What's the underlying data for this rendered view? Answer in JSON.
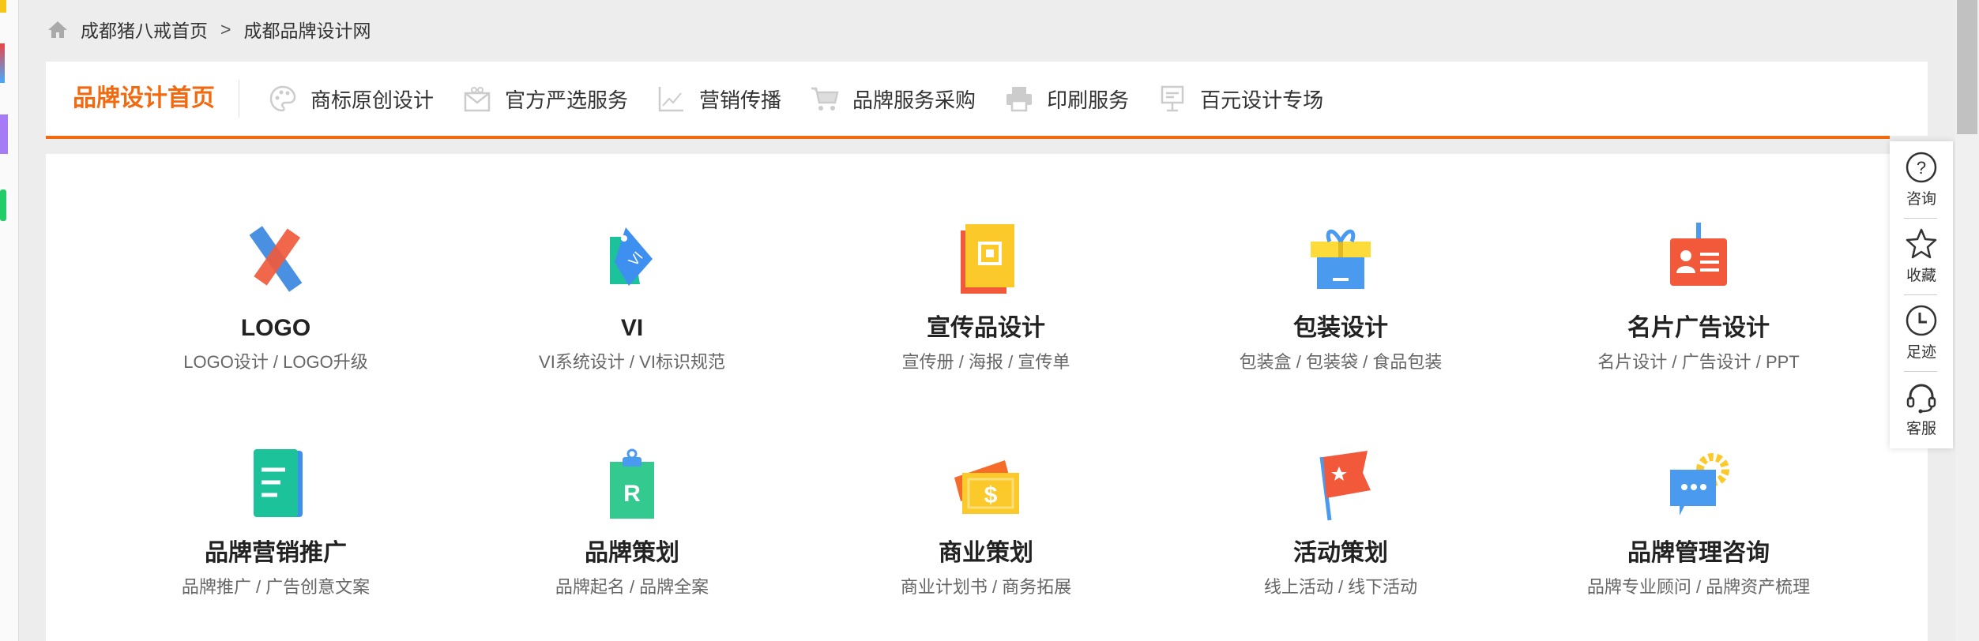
{
  "breadcrumb": {
    "home": "成都猪八戒首页",
    "separator": ">",
    "current": "成都品牌设计网"
  },
  "nav": {
    "title": "品牌设计首页",
    "items": [
      {
        "label": "商标原创设计",
        "icon": "palette-icon"
      },
      {
        "label": "官方严选服务",
        "icon": "envelope-icon"
      },
      {
        "label": "营销传播",
        "icon": "line-chart-icon"
      },
      {
        "label": "品牌服务采购",
        "icon": "cart-icon"
      },
      {
        "label": "印刷服务",
        "icon": "printer-icon"
      },
      {
        "label": "百元设计专场",
        "icon": "easel-icon"
      }
    ]
  },
  "categories": [
    {
      "title": "LOGO",
      "sub": "LOGO设计 / LOGO升级",
      "icon": "pencil-ruler-icon"
    },
    {
      "title": "VI",
      "sub": "VI系统设计 / VI标识规范",
      "icon": "tag-icon"
    },
    {
      "title": "宣传品设计",
      "sub": "宣传册 / 海报 / 宣传单",
      "icon": "flyer-qr-icon"
    },
    {
      "title": "包装设计",
      "sub": "包装盒 / 包装袋 / 食品包装",
      "icon": "gift-box-icon"
    },
    {
      "title": "名片广告设计",
      "sub": "名片设计 / 广告设计 / PPT",
      "icon": "id-card-icon"
    },
    {
      "title": "品牌营销推广",
      "sub": "品牌推广 / 广告创意文案",
      "icon": "document-icon"
    },
    {
      "title": "品牌策划",
      "sub": "品牌起名 / 品牌全案",
      "icon": "clipboard-r-icon"
    },
    {
      "title": "商业策划",
      "sub": "商业计划书 / 商务拓展",
      "icon": "money-icon"
    },
    {
      "title": "活动策划",
      "sub": "线上活动 / 线下活动",
      "icon": "flag-icon"
    },
    {
      "title": "品牌管理咨询",
      "sub": "品牌专业顾问 / 品牌资产梳理",
      "icon": "chat-gear-icon"
    }
  ],
  "side": [
    {
      "label": "咨询",
      "icon": "question-icon"
    },
    {
      "label": "收藏",
      "icon": "star-icon"
    },
    {
      "label": "足迹",
      "icon": "clock-icon"
    },
    {
      "label": "客服",
      "icon": "headset-icon"
    }
  ],
  "colors": {
    "accent": "#f26a10"
  }
}
